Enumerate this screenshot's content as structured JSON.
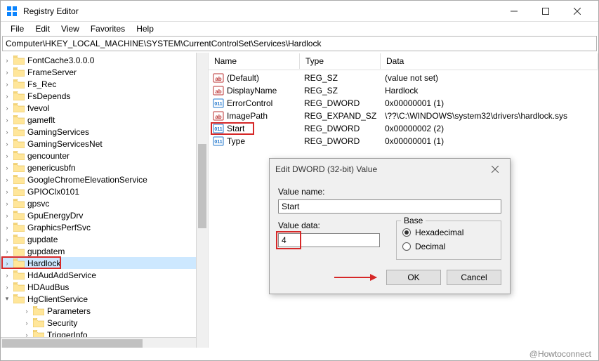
{
  "window": {
    "title": "Registry Editor"
  },
  "menu": {
    "file": "File",
    "edit": "Edit",
    "view": "View",
    "favorites": "Favorites",
    "help": "Help"
  },
  "address": "Computer\\HKEY_LOCAL_MACHINE\\SYSTEM\\CurrentControlSet\\Services\\Hardlock",
  "tree": {
    "items": [
      "FontCache3.0.0.0",
      "FrameServer",
      "Fs_Rec",
      "FsDepends",
      "fvevol",
      "gameflt",
      "GamingServices",
      "GamingServicesNet",
      "gencounter",
      "genericusbfn",
      "GoogleChromeElevationService",
      "GPIOClx0101",
      "gpsvc",
      "GpuEnergyDrv",
      "GraphicsPerfSvc",
      "gupdate",
      "gupdatem",
      "Hardlock",
      "HdAudAddService",
      "HDAudBus",
      "HgClientService"
    ],
    "sub_items": [
      "Parameters",
      "Security",
      "TriggerInfo"
    ],
    "selected_index": 17
  },
  "list": {
    "headers": {
      "name": "Name",
      "type": "Type",
      "data": "Data"
    },
    "rows": [
      {
        "icon": "sz",
        "name": "(Default)",
        "type": "REG_SZ",
        "data": "(value not set)"
      },
      {
        "icon": "sz",
        "name": "DisplayName",
        "type": "REG_SZ",
        "data": "Hardlock"
      },
      {
        "icon": "dw",
        "name": "ErrorControl",
        "type": "REG_DWORD",
        "data": "0x00000001 (1)"
      },
      {
        "icon": "sz",
        "name": "ImagePath",
        "type": "REG_EXPAND_SZ",
        "data": "\\??\\C:\\WINDOWS\\system32\\drivers\\hardlock.sys"
      },
      {
        "icon": "dw",
        "name": "Start",
        "type": "REG_DWORD",
        "data": "0x00000002 (2)"
      },
      {
        "icon": "dw",
        "name": "Type",
        "type": "REG_DWORD",
        "data": "0x00000001 (1)"
      }
    ],
    "highlight_index": 4
  },
  "dialog": {
    "title": "Edit DWORD (32-bit) Value",
    "value_name_label": "Value name:",
    "value_name": "Start",
    "value_data_label": "Value data:",
    "value_data": "4",
    "base_label": "Base",
    "hex": "Hexadecimal",
    "dec": "Decimal",
    "ok": "OK",
    "cancel": "Cancel"
  },
  "watermark": "@Howtoconnect"
}
